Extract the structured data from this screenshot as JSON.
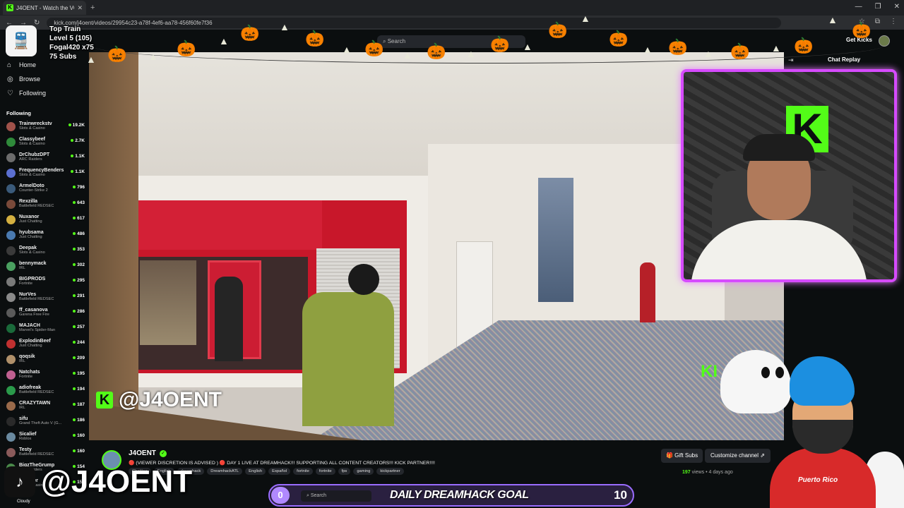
{
  "browser": {
    "tab_title": "J4OENT - Watch the VOD o",
    "tab_close": "✕",
    "tab_new": "+",
    "url": "kick.com/j4oent/videos/29954c23-a78f-4ef6-aa78-456f60fe7f36",
    "window_controls": [
      "—",
      "❐",
      "✕"
    ]
  },
  "header": {
    "search_placeholder": "Search",
    "get_kicks": "Get Kicks"
  },
  "sidebar": {
    "nav": [
      {
        "icon": "⌂",
        "label": "Home"
      },
      {
        "icon": "◎",
        "label": "Browse"
      },
      {
        "icon": "♡",
        "label": "Following"
      }
    ],
    "following_header": "Following",
    "channels": [
      {
        "name": "Trainwreckstv",
        "category": "Slots & Casino",
        "viewers": "19.2K",
        "color": "#a0524a"
      },
      {
        "name": "Classybeef",
        "category": "Slots & Casino",
        "viewers": "2.7K",
        "color": "#2f8a3a"
      },
      {
        "name": "DrChubzDPT",
        "category": "ARC Raiders",
        "viewers": "1.1K",
        "color": "#6c6c6c"
      },
      {
        "name": "FrequencyBenders",
        "category": "Slots & Casino",
        "viewers": "1.1K",
        "color": "#5b6fd0"
      },
      {
        "name": "ArmelDoto",
        "category": "Counter-Strike 2",
        "viewers": "796",
        "color": "#3a5a7a"
      },
      {
        "name": "Rexzilla",
        "category": "Battlefield REDSEC",
        "viewers": "643",
        "color": "#7a4a3a"
      },
      {
        "name": "Nuxanor",
        "category": "Just Chatting",
        "viewers": "617",
        "color": "#d4b040"
      },
      {
        "name": "hyubsama",
        "category": "Just Chatting",
        "viewers": "486",
        "color": "#4a7ab0"
      },
      {
        "name": "Deepak",
        "category": "Slots & Casino",
        "viewers": "353",
        "color": "#3a3a3a"
      },
      {
        "name": "bennymack",
        "category": "IRL",
        "viewers": "302",
        "color": "#4aa060"
      },
      {
        "name": "BIGPRODS",
        "category": "Fortnite",
        "viewers": "295",
        "color": "#7a7a7a"
      },
      {
        "name": "NurVes",
        "category": "Battlefield REDSEC",
        "viewers": "291",
        "color": "#8a8a8a"
      },
      {
        "name": "ff_casanova",
        "category": "Garena Free Fire",
        "viewers": "286",
        "color": "#5a5a5a"
      },
      {
        "name": "MAJACH",
        "category": "Marvel's Spider-Man",
        "viewers": "257",
        "color": "#1a6a3a"
      },
      {
        "name": "ExplodinBeef",
        "category": "Just Chatting",
        "viewers": "244",
        "color": "#c03030"
      },
      {
        "name": "qoqsik",
        "category": "IRL",
        "viewers": "209",
        "color": "#b0906a"
      },
      {
        "name": "Natchats",
        "category": "Fortnite",
        "viewers": "195",
        "color": "#c06090"
      },
      {
        "name": "adiofreak",
        "category": "Battlefield REDSEC",
        "viewers": "194",
        "color": "#2a9a4a"
      },
      {
        "name": "CRAZYTAWN",
        "category": "IRL",
        "viewers": "187",
        "color": "#9a6a4a"
      },
      {
        "name": "sifu",
        "category": "Grand Theft Auto V (G...",
        "viewers": "186",
        "color": "#2a2a2a"
      },
      {
        "name": "Sicalief",
        "category": "Roblox",
        "viewers": "160",
        "color": "#6a8aa0"
      },
      {
        "name": "Testy",
        "category": "Battlefield REDSEC",
        "viewers": "160",
        "color": "#8a5a5a"
      },
      {
        "name": "BigzTheGrump",
        "category": "ARC Raiders",
        "viewers": "154",
        "color": "#4a8a4a"
      },
      {
        "name": "Grasper",
        "category": "Slots & Casino",
        "viewers": "153",
        "color": "#a04a4a"
      }
    ]
  },
  "video": {
    "watermark_handle": "@J4OENT",
    "watermark_logo": "K"
  },
  "webcam": {
    "logo": "K"
  },
  "chat": {
    "title": "Chat Replay",
    "icon": "⇥"
  },
  "channel": {
    "name": "J4OENT",
    "verified": "✓",
    "stream_title": "🔴 (VIEWER DISCRETION IS ADVISED ) 🔴 DAY 1 LIVE AT DREAMHACK!!! SUPPORTING ALL CONTENT CREATORS!!! KICK PARTNER!!!!",
    "tags": [
      "Chatting",
      "English",
      "dreamhack",
      "DreamhackATL",
      "English",
      "Español",
      "fortnite",
      "fortnite",
      "fps",
      "gaming",
      "kickpartner"
    ],
    "gift_subs": "🎁 Gift Subs",
    "customize": "Customize channel ⇗",
    "views_count": "197",
    "views_label": " views  •  4 days ago"
  },
  "overlay": {
    "train_icon": "🚆",
    "train_lines": [
      "Top Train",
      "Level 5  (105)",
      "Fogal420 x75",
      "75 Subs"
    ],
    "tiktok_icon": "♪",
    "tiktok_handle": "@J4OENT",
    "weather": "Cloudy",
    "goal_start": "0",
    "goal_search": "Search",
    "goal_label": "DAILY DREAMHACK GOAL",
    "goal_end": "10",
    "kick_mini": "KI",
    "mascot_text": "Puerto Rico",
    "pumpkin": "🎃",
    "hat": "▲"
  },
  "colors": {
    "kick_green": "#53fc18",
    "webcam_border": "#d64bff",
    "goal_purple": "#9a6cff"
  }
}
